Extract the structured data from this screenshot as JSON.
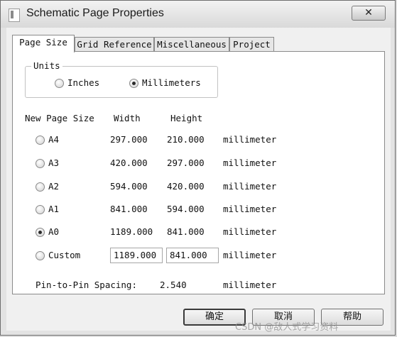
{
  "window": {
    "title": "Schematic Page Properties",
    "close_label": "✕"
  },
  "tabs": [
    {
      "label": "Page Size",
      "active": true
    },
    {
      "label": "Grid Reference",
      "active": false
    },
    {
      "label": "Miscellaneous",
      "active": false
    },
    {
      "label": "Project",
      "active": false
    }
  ],
  "units": {
    "group_label": "Units",
    "options": [
      {
        "label": "Inches",
        "selected": false
      },
      {
        "label": "Millimeters",
        "selected": true
      }
    ]
  },
  "page_size": {
    "headers": {
      "name": "New Page Size",
      "width": "Width",
      "height": "Height"
    },
    "rows": [
      {
        "name": "A4",
        "width": "297.000",
        "height": "210.000",
        "unit": "millimeter",
        "selected": false
      },
      {
        "name": "A3",
        "width": "420.000",
        "height": "297.000",
        "unit": "millimeter",
        "selected": false
      },
      {
        "name": "A2",
        "width": "594.000",
        "height": "420.000",
        "unit": "millimeter",
        "selected": false
      },
      {
        "name": "A1",
        "width": "841.000",
        "height": "594.000",
        "unit": "millimeter",
        "selected": false
      },
      {
        "name": "A0",
        "width": "1189.000",
        "height": "841.000",
        "unit": "millimeter",
        "selected": true
      }
    ],
    "custom": {
      "name": "Custom",
      "width": "1189.000",
      "height": "841.000",
      "unit": "millimeter",
      "selected": false
    }
  },
  "pin_spacing": {
    "label": "Pin-to-Pin Spacing:",
    "value": "2.540",
    "unit": "millimeter"
  },
  "buttons": {
    "ok": "确定",
    "cancel": "取消",
    "help": "帮助"
  },
  "watermark": "CSDN @敌人式学习资料"
}
